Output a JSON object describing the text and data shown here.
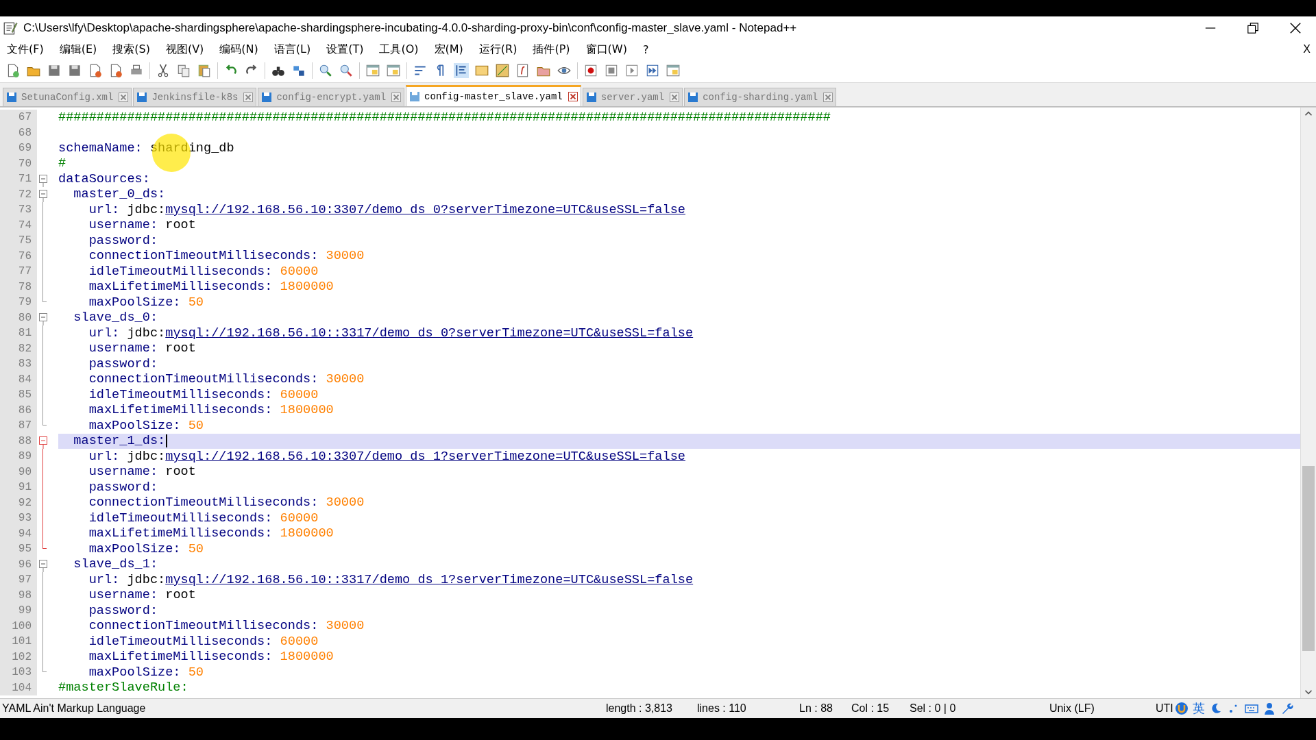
{
  "window": {
    "title": "C:\\Users\\lfy\\Desktop\\apache-shardingsphere\\apache-shardingsphere-incubating-4.0.0-sharding-proxy-bin\\conf\\config-master_slave.yaml - Notepad++"
  },
  "menu": [
    "文件(F)",
    "编辑(E)",
    "搜索(S)",
    "视图(V)",
    "编码(N)",
    "语言(L)",
    "设置(T)",
    "工具(O)",
    "宏(M)",
    "运行(R)",
    "插件(P)",
    "窗口(W)",
    "?"
  ],
  "close_doc": "X",
  "tabs": [
    {
      "label": "SetunaConfig.xml",
      "selected": false
    },
    {
      "label": "Jenkinsfile-k8s",
      "selected": false
    },
    {
      "label": "config-encrypt.yaml",
      "selected": false
    },
    {
      "label": "config-master_slave.yaml",
      "selected": true
    },
    {
      "label": "server.yaml",
      "selected": false
    },
    {
      "label": "config-sharding.yaml",
      "selected": false
    }
  ],
  "lines": [
    {
      "number": "67",
      "kind": "plain",
      "current": false,
      "segments": [
        {
          "kind": "comment",
          "text": "#####################################################################################################"
        }
      ]
    },
    {
      "number": "68",
      "kind": "plain"
    },
    {
      "number": "69",
      "kind": "plain",
      "current": false,
      "segments": [
        {
          "kind": "key",
          "text": "schemaName:"
        },
        {
          "kind": "text",
          "text": " sharding_db"
        }
      ]
    },
    {
      "number": "70",
      "kind": "plain",
      "current": false,
      "segments": [
        {
          "kind": "comment",
          "text": "#"
        }
      ]
    },
    {
      "number": "71",
      "kind": "fold-start",
      "current": false,
      "active": false,
      "segments": [
        {
          "kind": "key",
          "text": "dataSources:"
        }
      ]
    },
    {
      "number": "72",
      "kind": "fold-start",
      "current": false,
      "active": false,
      "segments": [
        {
          "kind": "key",
          "text": "  master_0_ds:"
        }
      ]
    },
    {
      "number": "73",
      "kind": "fold-body",
      "current": false,
      "active": false,
      "segments": [
        {
          "kind": "key",
          "text": "    url:"
        },
        {
          "kind": "text",
          "text": " jdbc:"
        },
        {
          "kind": "link",
          "text": "mysql://192.168.56.10:3307/demo_ds_0?serverTimezone=UTC&useSSL=false"
        }
      ]
    },
    {
      "number": "74",
      "kind": "fold-body",
      "current": false,
      "active": false,
      "segments": [
        {
          "kind": "key",
          "text": "    username:"
        },
        {
          "kind": "text",
          "text": " root"
        }
      ]
    },
    {
      "number": "75",
      "kind": "fold-body",
      "current": false,
      "active": false,
      "segments": [
        {
          "kind": "key",
          "text": "    password:"
        }
      ]
    },
    {
      "number": "76",
      "kind": "fold-body",
      "current": false,
      "active": false,
      "segments": [
        {
          "kind": "key",
          "text": "    connectionTimeoutMilliseconds:"
        },
        {
          "kind": "number",
          "text": " 30000"
        }
      ]
    },
    {
      "number": "77",
      "kind": "fold-body",
      "current": false,
      "active": false,
      "segments": [
        {
          "kind": "key",
          "text": "    idleTimeoutMilliseconds:"
        },
        {
          "kind": "number",
          "text": " 60000"
        }
      ]
    },
    {
      "number": "78",
      "kind": "fold-body",
      "current": false,
      "active": false,
      "segments": [
        {
          "kind": "key",
          "text": "    maxLifetimeMilliseconds:"
        },
        {
          "kind": "number",
          "text": " 1800000"
        }
      ]
    },
    {
      "number": "79",
      "kind": "fold-end",
      "current": false,
      "active": false,
      "segments": [
        {
          "kind": "key",
          "text": "    maxPoolSize:"
        },
        {
          "kind": "number",
          "text": " 50"
        }
      ]
    },
    {
      "number": "80",
      "kind": "fold-start",
      "current": false,
      "active": false,
      "segments": [
        {
          "kind": "key",
          "text": "  slave_ds_0:"
        }
      ]
    },
    {
      "number": "81",
      "kind": "fold-body",
      "current": false,
      "active": false,
      "segments": [
        {
          "kind": "key",
          "text": "    url:"
        },
        {
          "kind": "text",
          "text": " jdbc:"
        },
        {
          "kind": "link",
          "text": "mysql://192.168.56.10::3317/demo_ds_0?serverTimezone=UTC&useSSL=false"
        }
      ]
    },
    {
      "number": "82",
      "kind": "fold-body",
      "current": false,
      "active": false,
      "segments": [
        {
          "kind": "key",
          "text": "    username:"
        },
        {
          "kind": "text",
          "text": " root"
        }
      ]
    },
    {
      "number": "83",
      "kind": "fold-body",
      "current": false,
      "active": false,
      "segments": [
        {
          "kind": "key",
          "text": "    password:"
        }
      ]
    },
    {
      "number": "84",
      "kind": "fold-body",
      "current": false,
      "active": false,
      "segments": [
        {
          "kind": "key",
          "text": "    connectionTimeoutMilliseconds:"
        },
        {
          "kind": "number",
          "text": " 30000"
        }
      ]
    },
    {
      "number": "85",
      "kind": "fold-body",
      "current": false,
      "active": false,
      "segments": [
        {
          "kind": "key",
          "text": "    idleTimeoutMilliseconds:"
        },
        {
          "kind": "number",
          "text": " 60000"
        }
      ]
    },
    {
      "number": "86",
      "kind": "fold-body",
      "current": false,
      "active": false,
      "segments": [
        {
          "kind": "key",
          "text": "    maxLifetimeMilliseconds:"
        },
        {
          "kind": "number",
          "text": " 1800000"
        }
      ]
    },
    {
      "number": "87",
      "kind": "fold-end",
      "current": false,
      "active": false,
      "segments": [
        {
          "kind": "key",
          "text": "    maxPoolSize:"
        },
        {
          "kind": "number",
          "text": " 50"
        }
      ]
    },
    {
      "number": "88",
      "kind": "fold-start",
      "current": true,
      "active": true,
      "segments": [
        {
          "kind": "key",
          "text": "  master_1_ds:"
        }
      ]
    },
    {
      "number": "89",
      "kind": "fold-body",
      "current": false,
      "active": true,
      "segments": [
        {
          "kind": "key",
          "text": "    url:"
        },
        {
          "kind": "text",
          "text": " jdbc:"
        },
        {
          "kind": "link",
          "text": "mysql://192.168.56.10:3307/demo_ds_1?serverTimezone=UTC&useSSL=false"
        }
      ]
    },
    {
      "number": "90",
      "kind": "fold-body",
      "current": false,
      "active": true,
      "segments": [
        {
          "kind": "key",
          "text": "    username:"
        },
        {
          "kind": "text",
          "text": " root"
        }
      ]
    },
    {
      "number": "91",
      "kind": "fold-body",
      "current": false,
      "active": true,
      "segments": [
        {
          "kind": "key",
          "text": "    password:"
        }
      ]
    },
    {
      "number": "92",
      "kind": "fold-body",
      "current": false,
      "active": true,
      "segments": [
        {
          "kind": "key",
          "text": "    connectionTimeoutMilliseconds:"
        },
        {
          "kind": "number",
          "text": " 30000"
        }
      ]
    },
    {
      "number": "93",
      "kind": "fold-body",
      "current": false,
      "active": true,
      "segments": [
        {
          "kind": "key",
          "text": "    idleTimeoutMilliseconds:"
        },
        {
          "kind": "number",
          "text": " 60000"
        }
      ]
    },
    {
      "number": "94",
      "kind": "fold-body",
      "current": false,
      "active": true,
      "segments": [
        {
          "kind": "key",
          "text": "    maxLifetimeMilliseconds:"
        },
        {
          "kind": "number",
          "text": " 1800000"
        }
      ]
    },
    {
      "number": "95",
      "kind": "fold-end",
      "current": false,
      "active": true,
      "segments": [
        {
          "kind": "key",
          "text": "    maxPoolSize:"
        },
        {
          "kind": "number",
          "text": " 50"
        }
      ]
    },
    {
      "number": "96",
      "kind": "fold-start",
      "current": false,
      "active": false,
      "segments": [
        {
          "kind": "key",
          "text": "  slave_ds_1:"
        }
      ]
    },
    {
      "number": "97",
      "kind": "fold-body",
      "current": false,
      "active": false,
      "segments": [
        {
          "kind": "key",
          "text": "    url:"
        },
        {
          "kind": "text",
          "text": " jdbc:"
        },
        {
          "kind": "link",
          "text": "mysql://192.168.56.10::3317/demo_ds_1?serverTimezone=UTC&useSSL=false"
        }
      ]
    },
    {
      "number": "98",
      "kind": "fold-body",
      "current": false,
      "active": false,
      "segments": [
        {
          "kind": "key",
          "text": "    username:"
        },
        {
          "kind": "text",
          "text": " root"
        }
      ]
    },
    {
      "number": "99",
      "kind": "fold-body",
      "current": false,
      "active": false,
      "segments": [
        {
          "kind": "key",
          "text": "    password:"
        }
      ]
    },
    {
      "number": "100",
      "kind": "fold-body",
      "current": false,
      "active": false,
      "segments": [
        {
          "kind": "key",
          "text": "    connectionTimeoutMilliseconds:"
        },
        {
          "kind": "number",
          "text": " 30000"
        }
      ]
    },
    {
      "number": "101",
      "kind": "fold-body",
      "current": false,
      "active": false,
      "segments": [
        {
          "kind": "key",
          "text": "    idleTimeoutMilliseconds:"
        },
        {
          "kind": "number",
          "text": " 60000"
        }
      ]
    },
    {
      "number": "102",
      "kind": "fold-body",
      "current": false,
      "active": false,
      "segments": [
        {
          "kind": "key",
          "text": "    maxLifetimeMilliseconds:"
        },
        {
          "kind": "number",
          "text": " 1800000"
        }
      ]
    },
    {
      "number": "103",
      "kind": "fold-end",
      "current": false,
      "active": false,
      "segments": [
        {
          "kind": "key",
          "text": "    maxPoolSize:"
        },
        {
          "kind": "number",
          "text": " 50"
        }
      ]
    },
    {
      "number": "104",
      "kind": "plain",
      "current": false,
      "segments": [
        {
          "kind": "comment",
          "text": "#masterSlaveRule:"
        }
      ]
    }
  ],
  "status_bar": {
    "language": "YAML Ain't Markup Language",
    "length": "length : 3,813",
    "lines": "lines : 110",
    "ln": "Ln : 88",
    "col": "Col : 15",
    "sel": "Sel : 0 | 0",
    "eol": "Unix (LF)",
    "encoding": "UTI",
    "ime": "英"
  }
}
